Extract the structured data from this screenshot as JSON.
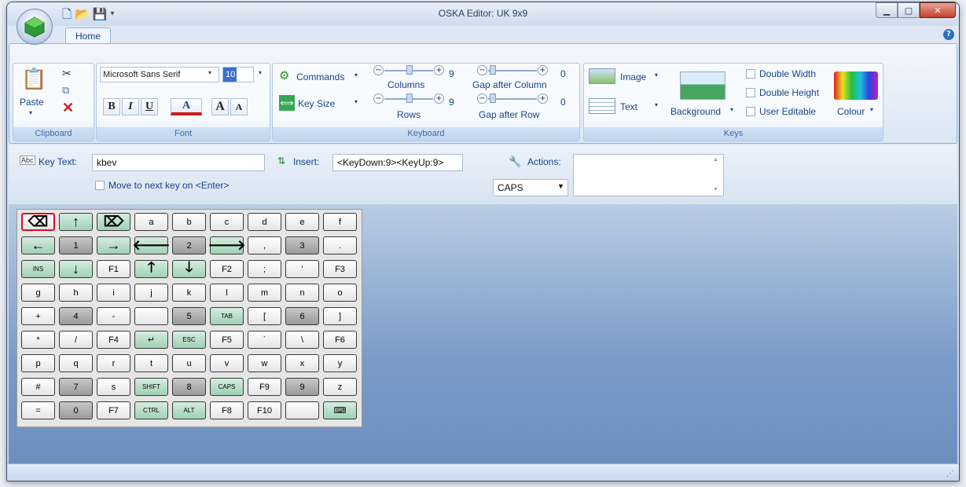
{
  "window": {
    "title": "OSKA Editor: UK 9x9"
  },
  "ribbon": {
    "tab": "Home",
    "clipboard": {
      "paste": "Paste",
      "title": "Clipboard"
    },
    "font": {
      "name": "Microsoft Sans Serif",
      "size": "10",
      "bold": "B",
      "italic": "I",
      "underline": "U",
      "color": "A",
      "grow": "A",
      "shrink": "A",
      "title": "Font"
    },
    "keyboard": {
      "commands": "Commands",
      "key_size": "Key Size",
      "columns": "Columns",
      "columns_val": "9",
      "rows": "Rows",
      "rows_val": "9",
      "gap_col": "Gap after Column",
      "gap_col_val": "0",
      "gap_row": "Gap after Row",
      "gap_row_val": "0",
      "title": "Keyboard"
    },
    "keys": {
      "image": "Image",
      "text": "Text",
      "background": "Background",
      "double_width": "Double Width",
      "double_height": "Double Height",
      "user_editable": "User Editable",
      "colour": "Colour",
      "title": "Keys"
    }
  },
  "panel": {
    "key_text_label": "Key Text:",
    "key_text_value": "kbev",
    "move_next": "Move to next key on <Enter>",
    "insert_label": "Insert:",
    "insert_value": "<KeyDown:9><KeyUp:9>",
    "actions_label": "Actions:",
    "actions_select": "CAPS"
  },
  "keyboard_rows": [
    [
      [
        "⌫",
        "w",
        "big sel"
      ],
      [
        "↑",
        "gr",
        "big"
      ],
      [
        "⌦",
        "gr",
        "big"
      ],
      [
        "a",
        "w",
        ""
      ],
      [
        "b",
        "w",
        ""
      ],
      [
        "c",
        "w",
        ""
      ],
      [
        "d",
        "w",
        ""
      ],
      [
        "e",
        "w",
        ""
      ],
      [
        "f",
        "w",
        ""
      ]
    ],
    [
      [
        "←",
        "gr",
        "big"
      ],
      [
        "1",
        "g",
        ""
      ],
      [
        "→",
        "gr",
        "big"
      ],
      [
        "🡐",
        "gr",
        "big"
      ],
      [
        "2",
        "g",
        ""
      ],
      [
        "🡒",
        "gr",
        "big"
      ],
      [
        ",",
        "w",
        ""
      ],
      [
        "3",
        "g",
        ""
      ],
      [
        ".",
        "w",
        ""
      ]
    ],
    [
      [
        "INS",
        "gr",
        "sm"
      ],
      [
        "↓",
        "gr",
        "big"
      ],
      [
        "F1",
        "w",
        ""
      ],
      [
        "🡑",
        "gr",
        "big"
      ],
      [
        "🡓",
        "gr",
        "big"
      ],
      [
        "F2",
        "w",
        ""
      ],
      [
        ";",
        "w",
        ""
      ],
      [
        "'",
        "w",
        ""
      ],
      [
        "F3",
        "w",
        ""
      ]
    ],
    [
      [
        "g",
        "w",
        ""
      ],
      [
        "h",
        "w",
        ""
      ],
      [
        "i",
        "w",
        ""
      ],
      [
        "j",
        "w",
        ""
      ],
      [
        "k",
        "w",
        ""
      ],
      [
        "l",
        "w",
        ""
      ],
      [
        "m",
        "w",
        ""
      ],
      [
        "n",
        "w",
        ""
      ],
      [
        "o",
        "w",
        ""
      ]
    ],
    [
      [
        "+",
        "w",
        ""
      ],
      [
        "4",
        "g",
        ""
      ],
      [
        "-",
        "w",
        ""
      ],
      [
        "",
        "w",
        ""
      ],
      [
        "5",
        "g",
        ""
      ],
      [
        "TAB",
        "gr",
        "sm"
      ],
      [
        "[",
        "w",
        ""
      ],
      [
        "6",
        "g",
        ""
      ],
      [
        "]",
        "w",
        ""
      ]
    ],
    [
      [
        "*",
        "w",
        ""
      ],
      [
        "/",
        "w",
        ""
      ],
      [
        "F4",
        "w",
        ""
      ],
      [
        "↵",
        "gr",
        ""
      ],
      [
        "ESC",
        "gr",
        "sm"
      ],
      [
        "F5",
        "w",
        ""
      ],
      [
        "`",
        "w",
        ""
      ],
      [
        "\\",
        "w",
        ""
      ],
      [
        "F6",
        "w",
        ""
      ]
    ],
    [
      [
        "p",
        "w",
        ""
      ],
      [
        "q",
        "w",
        ""
      ],
      [
        "r",
        "w",
        ""
      ],
      [
        "t",
        "w",
        ""
      ],
      [
        "u",
        "w",
        ""
      ],
      [
        "v",
        "w",
        ""
      ],
      [
        "w",
        "w",
        ""
      ],
      [
        "x",
        "w",
        ""
      ],
      [
        "y",
        "w",
        ""
      ]
    ],
    [
      [
        "#",
        "w",
        ""
      ],
      [
        "7",
        "g",
        ""
      ],
      [
        "s",
        "w",
        ""
      ],
      [
        "SHIFT",
        "gr",
        "sm"
      ],
      [
        "8",
        "g",
        ""
      ],
      [
        "CAPS",
        "gr",
        "sm"
      ],
      [
        "F9",
        "w",
        ""
      ],
      [
        "9",
        "g",
        ""
      ],
      [
        "z",
        "w",
        ""
      ]
    ],
    [
      [
        "=",
        "w",
        ""
      ],
      [
        "0",
        "g",
        ""
      ],
      [
        "F7",
        "w",
        ""
      ],
      [
        "CTRL",
        "gr",
        "sm"
      ],
      [
        "ALT",
        "gr",
        "sm"
      ],
      [
        "F8",
        "w",
        ""
      ],
      [
        "F10",
        "w",
        ""
      ],
      [
        "",
        "w",
        ""
      ],
      [
        "⌨",
        "gr",
        ""
      ]
    ]
  ]
}
